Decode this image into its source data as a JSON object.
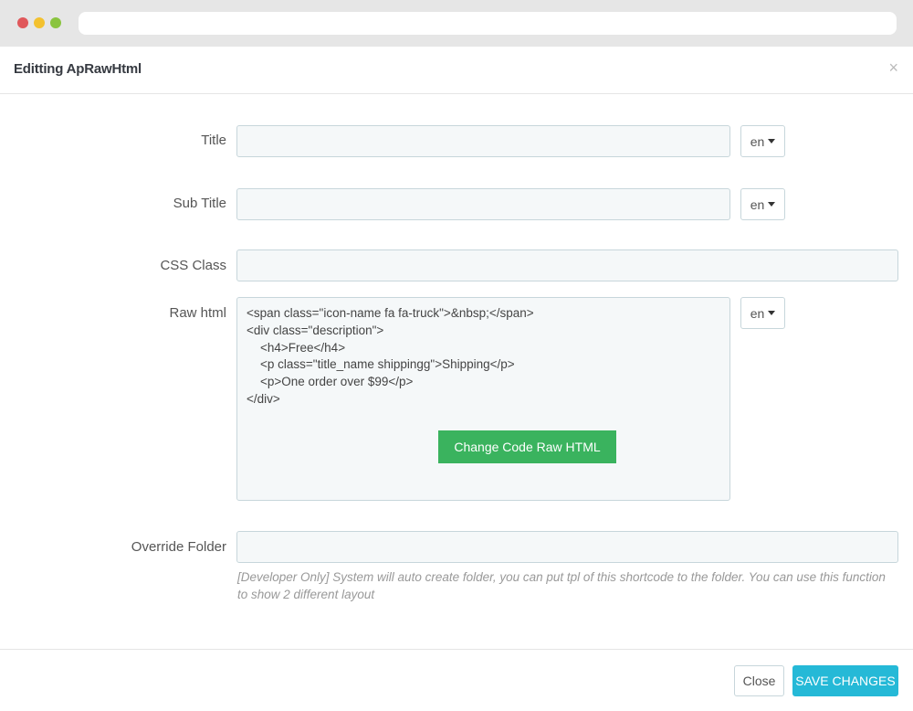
{
  "modal": {
    "title": "Editting ApRawHtml",
    "close_glyph": "×"
  },
  "fields": {
    "title": {
      "label": "Title",
      "value": "",
      "lang": "en"
    },
    "sub_title": {
      "label": "Sub Title",
      "value": "",
      "lang": "en"
    },
    "css_class": {
      "label": "CSS Class",
      "value": ""
    },
    "raw_html": {
      "label": "Raw html",
      "lang": "en",
      "code_lines": [
        "<span class=\"icon-name fa fa-truck\">&nbsp;</span>",
        "<div class=\"description\">",
        "    <h4>Free</h4>",
        "    <p class=\"title_name shippingg\">Shipping</p>",
        "    <p>One order over $99</p>",
        "</div>"
      ],
      "change_button": "Change Code Raw HTML"
    },
    "override_folder": {
      "label": "Override Folder",
      "value": "",
      "help": "[Developer Only] System will auto create folder, you can put tpl of this shortcode to the folder. You can use this function to show 2 different layout"
    }
  },
  "footer": {
    "close_label": "Close",
    "save_label": "SAVE CHANGES"
  },
  "colors": {
    "save_button": "#25b9d7",
    "change_button": "#3ab35e",
    "input_bg": "#f5f8f9"
  }
}
